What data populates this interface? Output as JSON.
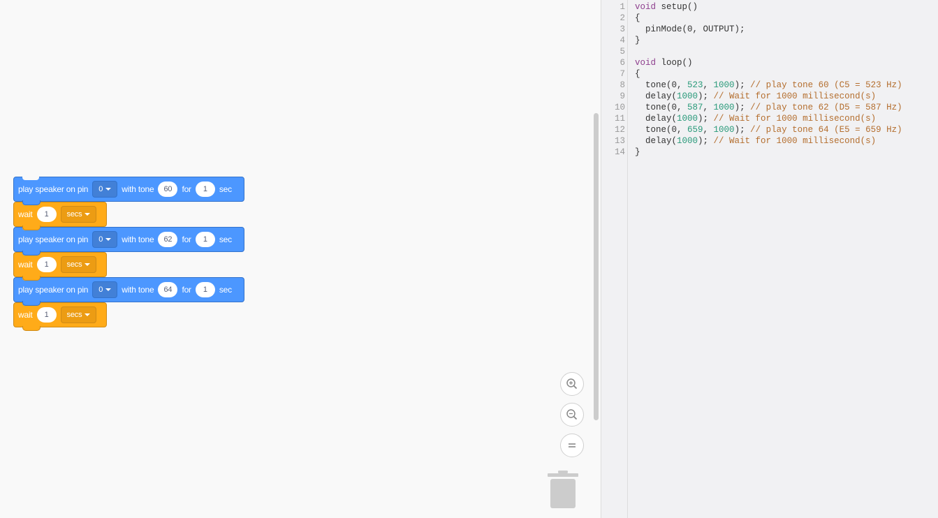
{
  "workspace": {
    "blocks": [
      {
        "type": "speaker",
        "label": "play speaker on pin",
        "pin": "0",
        "tone_label": "with tone",
        "tone": "60",
        "for_label": "for",
        "duration": "1",
        "unit": "sec"
      },
      {
        "type": "wait",
        "label": "wait",
        "value": "1",
        "unit": "secs"
      },
      {
        "type": "speaker",
        "label": "play speaker on pin",
        "pin": "0",
        "tone_label": "with tone",
        "tone": "62",
        "for_label": "for",
        "duration": "1",
        "unit": "sec"
      },
      {
        "type": "wait",
        "label": "wait",
        "value": "1",
        "unit": "secs"
      },
      {
        "type": "speaker",
        "label": "play speaker on pin",
        "pin": "0",
        "tone_label": "with tone",
        "tone": "64",
        "for_label": "for",
        "duration": "1",
        "unit": "sec"
      },
      {
        "type": "wait",
        "label": "wait",
        "value": "1",
        "unit": "secs"
      }
    ],
    "zoom_controls": [
      "zoom-in-icon",
      "zoom-out-icon",
      "zoom-reset-icon"
    ],
    "trash_icon": "trash-icon"
  },
  "code": {
    "lines": [
      [
        [
          "kw",
          "void"
        ],
        [
          "",
          "setup()"
        ]
      ],
      [
        [
          "",
          "{"
        ]
      ],
      [
        [
          "",
          "  pinMode(0, OUTPUT);"
        ]
      ],
      [
        [
          "",
          "}"
        ]
      ],
      [
        [
          "",
          ""
        ]
      ],
      [
        [
          "kw",
          "void"
        ],
        [
          "",
          "loop()"
        ]
      ],
      [
        [
          "",
          "{"
        ]
      ],
      [
        [
          "",
          "  tone(0, "
        ],
        [
          "num",
          "523"
        ],
        [
          "",
          ", "
        ],
        [
          "num",
          "1000"
        ],
        [
          "",
          "); "
        ],
        [
          "cm",
          "// play tone 60 (C5 = 523 Hz)"
        ]
      ],
      [
        [
          "",
          "  delay("
        ],
        [
          "num",
          "1000"
        ],
        [
          "",
          "); "
        ],
        [
          "cm",
          "// Wait for 1000 millisecond(s)"
        ]
      ],
      [
        [
          "",
          "  tone(0, "
        ],
        [
          "num",
          "587"
        ],
        [
          "",
          ", "
        ],
        [
          "num",
          "1000"
        ],
        [
          "",
          "); "
        ],
        [
          "cm",
          "// play tone 62 (D5 = 587 Hz)"
        ]
      ],
      [
        [
          "",
          "  delay("
        ],
        [
          "num",
          "1000"
        ],
        [
          "",
          "); "
        ],
        [
          "cm",
          "// Wait for 1000 millisecond(s)"
        ]
      ],
      [
        [
          "",
          "  tone(0, "
        ],
        [
          "num",
          "659"
        ],
        [
          "",
          ", "
        ],
        [
          "num",
          "1000"
        ],
        [
          "",
          "); "
        ],
        [
          "cm",
          "// play tone 64 (E5 = 659 Hz)"
        ]
      ],
      [
        [
          "",
          "  delay("
        ],
        [
          "num",
          "1000"
        ],
        [
          "",
          "); "
        ],
        [
          "cm",
          "// Wait for 1000 millisecond(s)"
        ]
      ],
      [
        [
          "",
          "}"
        ]
      ]
    ]
  },
  "colors": {
    "speaker": "#4c97ff",
    "wait": "#ffab19",
    "keyword": "#8e3f8e",
    "number": "#2a9a7a",
    "comment": "#b46e2e"
  }
}
